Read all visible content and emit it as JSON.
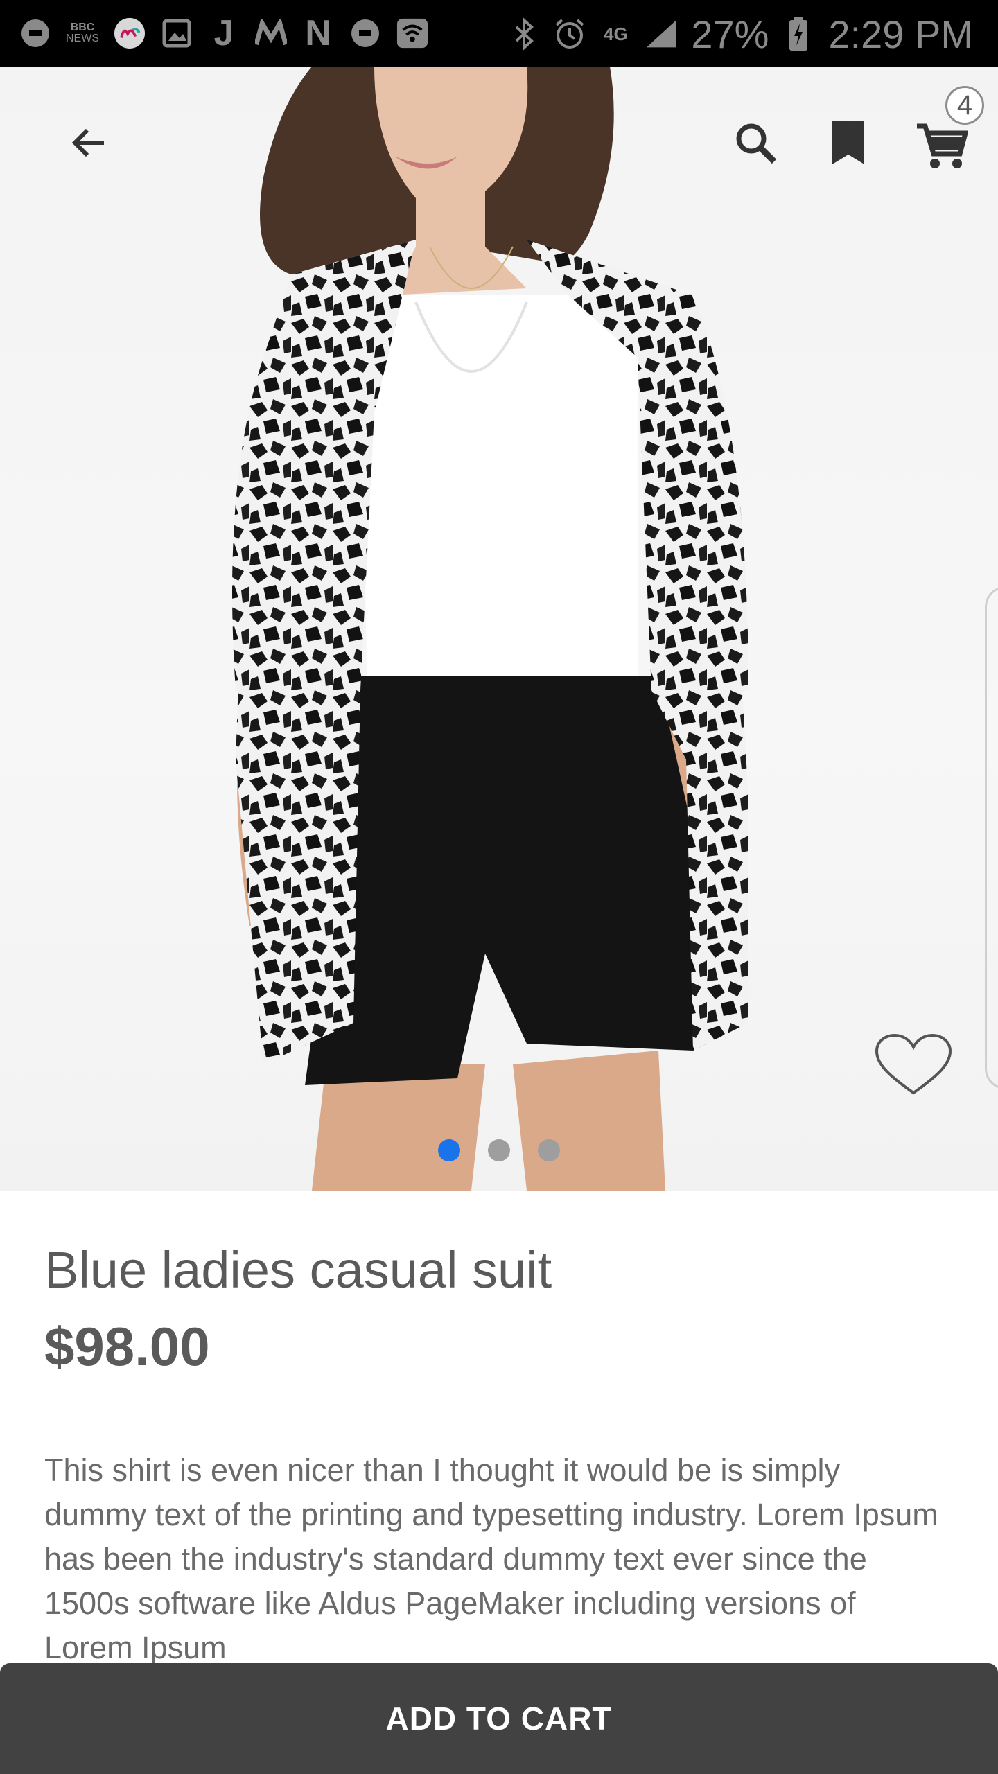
{
  "status_bar": {
    "icons": [
      "uber-icon",
      "bbc-news-icon",
      "mint-icon",
      "gallery-icon",
      "j-icon",
      "m-icon",
      "netflix-icon",
      "uber-icon",
      "wifi-icon",
      "bluetooth-icon",
      "alarm-icon",
      "4g-icon",
      "signal-icon",
      "battery-charging-icon"
    ],
    "bbc_label": "BBC",
    "news_label": "NEWS",
    "j_label": "J",
    "n_label": "N",
    "network": "4G",
    "battery": "27%",
    "time": "2:29 PM"
  },
  "toolbar": {
    "back_icon": "arrow-back-icon",
    "search_icon": "search-icon",
    "bookmark_icon": "bookmark-icon",
    "cart_icon": "cart-icon",
    "cart_count": "4"
  },
  "gallery": {
    "image_count": 3,
    "active_index": 0,
    "favorite_icon": "heart-outline-icon"
  },
  "product": {
    "title": "Blue ladies casual suit",
    "price": "$98.00",
    "description": "This shirt is even nicer than I thought it would be is simply dummy text of the printing and typesetting industry. Lorem Ipsum has been the industry's standard dummy text ever since the 1500s software like Aldus PageMaker including versions of Lorem Ipsum"
  },
  "actions": {
    "add_to_cart_label": "ADD TO CART"
  },
  "colors": {
    "accent": "#1a73e8",
    "button_bg": "#424242",
    "text": "#5a5a5a"
  }
}
